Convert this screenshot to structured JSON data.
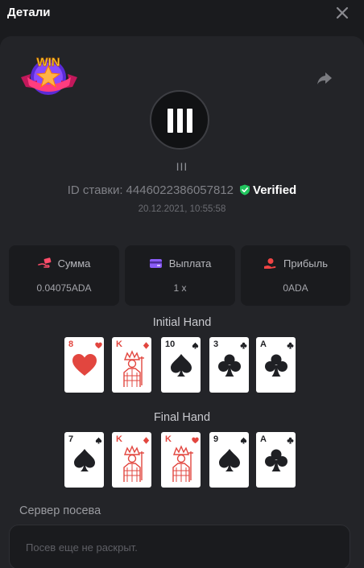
{
  "header": {
    "title": "Детали"
  },
  "game": {
    "name": "III"
  },
  "bet": {
    "id_label": "ID ставки:",
    "id_value": "4446022386057812",
    "verified_label": "Verified",
    "timestamp": "20.12.2021, 10:55:58"
  },
  "badge": {
    "text": "WIN"
  },
  "stats": [
    {
      "label": "Сумма",
      "value": "0.04075ADA",
      "icon": "money-hand-icon",
      "color": "#ff4d6a"
    },
    {
      "label": "Выплата",
      "value": "1 x",
      "icon": "wallet-icon",
      "color": "#8b5cf6"
    },
    {
      "label": "Прибыль",
      "value": "0ADA",
      "icon": "profit-hand-icon",
      "color": "#ef4444"
    }
  ],
  "initial_hand": {
    "title": "Initial Hand",
    "cards": [
      {
        "rank": "8",
        "suit": "hearts"
      },
      {
        "rank": "K",
        "suit": "diamonds"
      },
      {
        "rank": "10",
        "suit": "spades"
      },
      {
        "rank": "3",
        "suit": "clubs"
      },
      {
        "rank": "A",
        "suit": "clubs"
      }
    ]
  },
  "final_hand": {
    "title": "Final Hand",
    "cards": [
      {
        "rank": "7",
        "suit": "spades"
      },
      {
        "rank": "K",
        "suit": "diamonds"
      },
      {
        "rank": "K",
        "suit": "hearts"
      },
      {
        "rank": "9",
        "suit": "spades"
      },
      {
        "rank": "A",
        "suit": "clubs"
      }
    ]
  },
  "seed": {
    "label": "Сервер посева",
    "placeholder": "Посев еще не раскрыт."
  },
  "colors": {
    "background": "#1a1b1e",
    "panel": "#232428",
    "verified": "#22c55e",
    "card_red": "#e2463f",
    "card_black": "#1f2024"
  }
}
